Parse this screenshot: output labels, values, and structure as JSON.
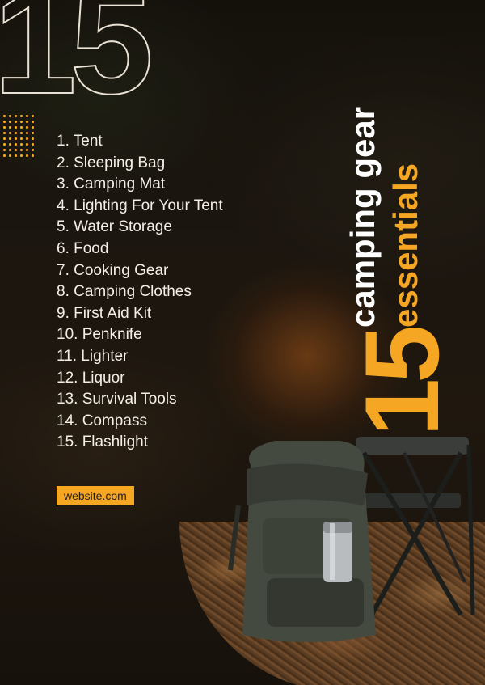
{
  "big_number_outline": "15",
  "big_number_solid": "15",
  "heading_line1": "camping gear",
  "heading_line2": "essentials",
  "items": [
    "1. Tent",
    "2. Sleeping Bag",
    "3. Camping Mat",
    "4. Lighting For Your Tent",
    "5. Water Storage",
    "6. Food",
    "7. Cooking Gear",
    "8. Camping Clothes",
    "9. First Aid Kit",
    "10. Penknife",
    "11. Lighter",
    "12. Liquor",
    "13. Survival Tools",
    "14. Compass",
    "15. Flashlight"
  ],
  "website": "website.com",
  "colors": {
    "accent": "#f5a623",
    "text": "#f4efe6",
    "background": "#1a1410"
  }
}
